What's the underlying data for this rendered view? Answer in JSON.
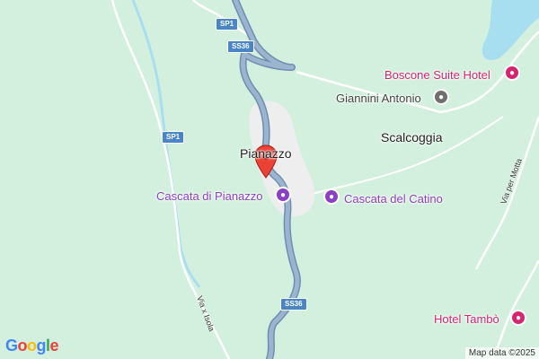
{
  "map": {
    "colors": {
      "terrain": "#d3f0de",
      "water": "#a8dff0",
      "road": "#8aa6c4",
      "road_outline": "#6f8db0",
      "minor_road": "#ffffff",
      "urban": "#eeeeee",
      "marker": "#ea4335"
    },
    "places": {
      "town": "Pianazzo",
      "village": "Scalcoggia"
    },
    "pois": {
      "cascata_pianazzo": "Cascata di Pianazzo",
      "cascata_catino": "Cascata del Catino",
      "boscone": "Boscone Suite Hotel",
      "giannini": "Giannini Antonio",
      "tambo": "Hotel Tambò"
    },
    "icons": {
      "camera": "camera-icon",
      "hotel": "bed-icon",
      "place": "place-icon",
      "marker": "location-pin-icon"
    },
    "shields": {
      "sp1_top": "SP1",
      "ss36_top": "SS36",
      "sp1_left": "SP1",
      "ss36_bottom": "SS36"
    },
    "roads": {
      "via_isola": "Via x Isola",
      "via_motta": "Via per Motta"
    },
    "logo": "Google",
    "attribution": "Map data ©2025"
  }
}
